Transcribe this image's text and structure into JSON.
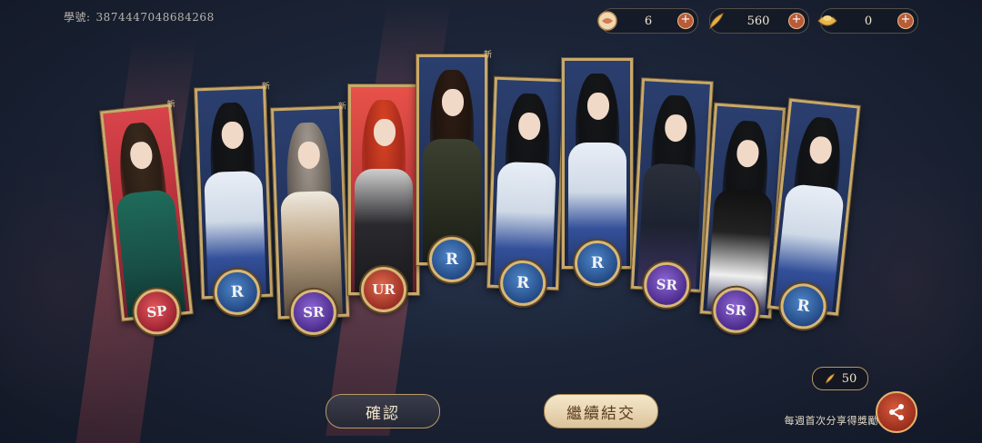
{
  "student": {
    "label": "學號:",
    "id": "3874447048684268"
  },
  "resources": [
    {
      "icon": "ticket-icon",
      "value": "6"
    },
    {
      "icon": "feather-icon",
      "value": "560"
    },
    {
      "icon": "ingot-icon",
      "value": "0"
    }
  ],
  "cards": [
    {
      "rarity": "SP",
      "new": "新"
    },
    {
      "rarity": "R",
      "new": "新"
    },
    {
      "rarity": "SR",
      "new": "新"
    },
    {
      "rarity": "UR",
      "new": "新"
    },
    {
      "rarity": "R",
      "new": "新"
    },
    {
      "rarity": "R",
      "new": ""
    },
    {
      "rarity": "R",
      "new": ""
    },
    {
      "rarity": "SR",
      "new": ""
    },
    {
      "rarity": "SR",
      "new": ""
    },
    {
      "rarity": "R",
      "new": ""
    }
  ],
  "buttons": {
    "confirm": "確認",
    "continue": "繼續結交"
  },
  "share": {
    "cost": "50",
    "text": "每週首次分享得獎勵"
  },
  "colors": {
    "gold": "#c9a96a",
    "R": "#244a85",
    "SR": "#4c2c8d",
    "SP": "#9d2331",
    "UR": "#9a2f25"
  }
}
